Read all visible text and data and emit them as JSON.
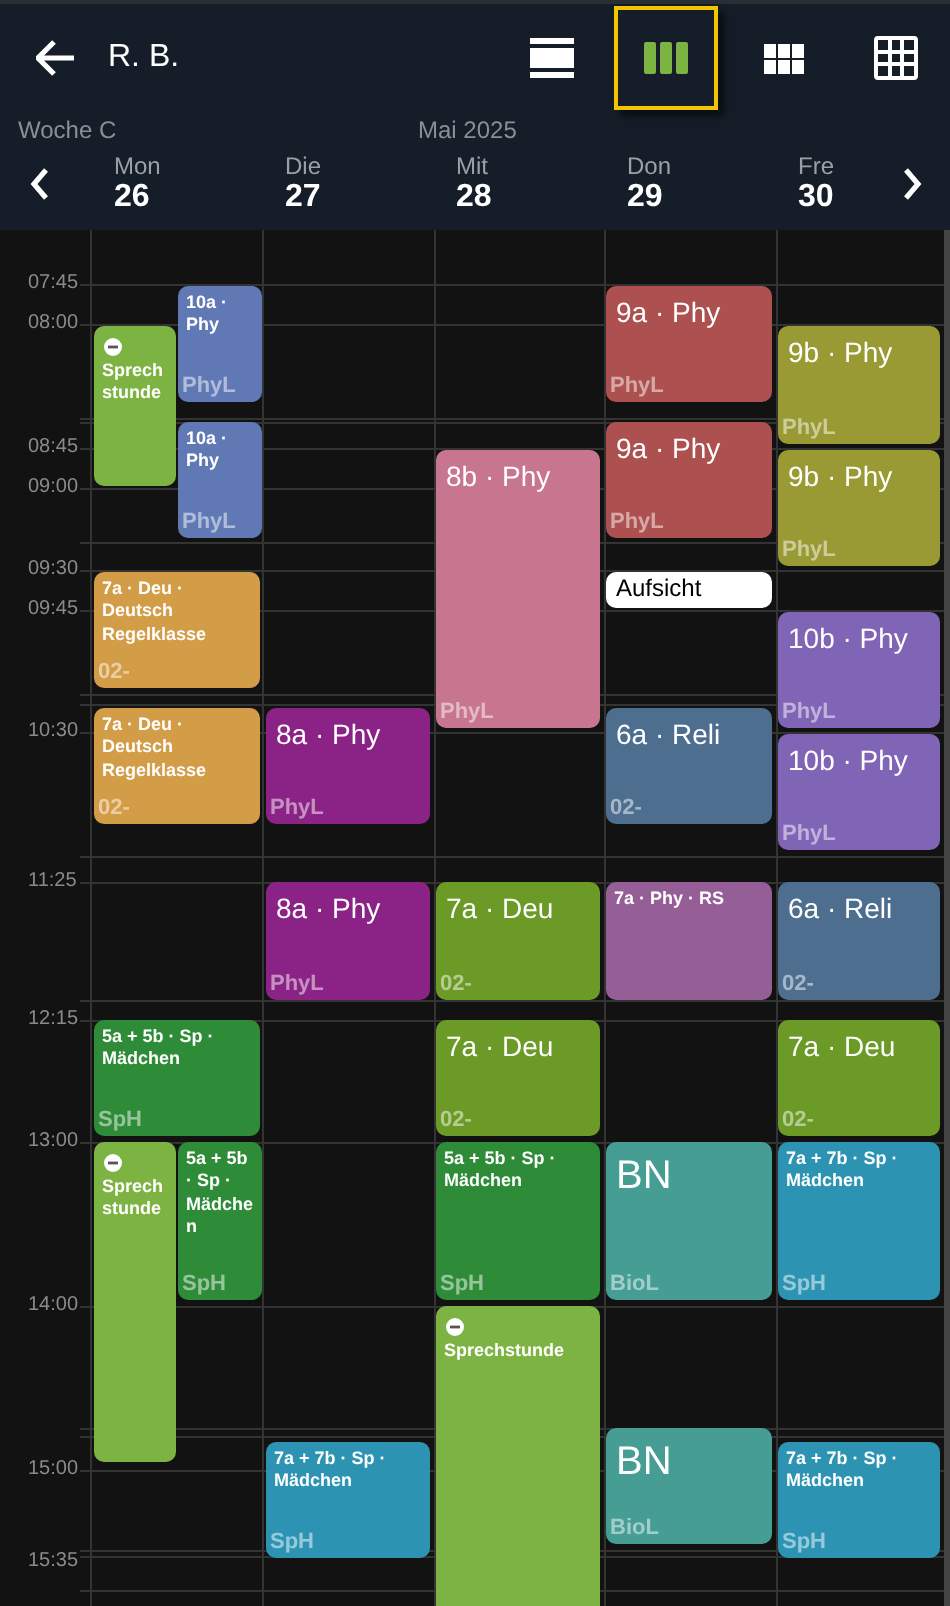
{
  "header": {
    "title": "R. B.",
    "views": [
      {
        "kind": "rows",
        "selected": false
      },
      {
        "kind": "columns",
        "selected": true
      },
      {
        "kind": "small-grid",
        "selected": false
      },
      {
        "kind": "big-grid",
        "selected": false
      }
    ]
  },
  "week": {
    "label": "Woche C",
    "month": "Mai 2025"
  },
  "times": [
    "07:45",
    "08:00",
    "08:45",
    "09:00",
    "09:30",
    "09:45",
    "10:30",
    "11:25",
    "12:15",
    "13:00",
    "14:00",
    "15:00",
    "15:35"
  ],
  "days": [
    {
      "name": "Mon",
      "date": "26",
      "events": [
        {
          "kind": "note",
          "title": "Sprechstunde",
          "color": "#7cb342"
        },
        {
          "kind": "lesson",
          "title": "10a · Phy",
          "room": "PhyL",
          "color": "#6079b5"
        },
        {
          "kind": "lesson",
          "title": "10a · Phy",
          "room": "PhyL",
          "color": "#6079b5"
        },
        {
          "kind": "lesson",
          "title": "7a · Deu · Deutsch Regelklasse",
          "room": "02-",
          "color": "#d39c46"
        },
        {
          "kind": "lesson",
          "title": "7a · Deu · Deutsch Regelklasse",
          "room": "02-",
          "color": "#d39c46"
        },
        {
          "kind": "lesson",
          "title": "5a + 5b · Sp · Mädchen",
          "room": "SpH",
          "color": "#2e8b37"
        },
        {
          "kind": "note",
          "title": "Sprechstunde",
          "color": "#7cb342"
        },
        {
          "kind": "lesson",
          "title": "5a + 5b · Sp · Mädchen",
          "room": "SpH",
          "color": "#2e8b37"
        }
      ]
    },
    {
      "name": "Die",
      "date": "27",
      "events": [
        {
          "kind": "lesson",
          "title": "8a · Phy",
          "room": "PhyL",
          "color": "#8b2386"
        },
        {
          "kind": "lesson",
          "title": "8a · Phy",
          "room": "PhyL",
          "color": "#8b2386"
        },
        {
          "kind": "lesson",
          "title": "7a + 7b · Sp · Mädchen",
          "room": "SpH",
          "color": "#2c93b2"
        }
      ]
    },
    {
      "name": "Mit",
      "date": "28",
      "events": [
        {
          "kind": "lesson",
          "title": "8b · Phy",
          "room": "PhyL",
          "color": "#c8758f"
        },
        {
          "kind": "lesson",
          "title": "7a · Deu",
          "room": "02-",
          "color": "#6b9a26"
        },
        {
          "kind": "lesson",
          "title": "7a · Deu",
          "room": "02-",
          "color": "#6b9a26"
        },
        {
          "kind": "lesson",
          "title": "5a + 5b · Sp · Mädchen",
          "room": "SpH",
          "color": "#2e8b37"
        },
        {
          "kind": "note",
          "title": "Sprechstunde",
          "color": "#7cb342"
        }
      ]
    },
    {
      "name": "Don",
      "date": "29",
      "events": [
        {
          "kind": "lesson",
          "title": "9a · Phy",
          "room": "PhyL",
          "color": "#ad5050"
        },
        {
          "kind": "lesson",
          "title": "9a · Phy",
          "room": "PhyL",
          "color": "#ad5050"
        },
        {
          "kind": "duty",
          "title": "Aufsicht",
          "color": "#ffffff"
        },
        {
          "kind": "lesson",
          "title": "6a · Reli",
          "room": "02-",
          "color": "#4d6e8e"
        },
        {
          "kind": "lesson",
          "title": "7a · Phy · RS",
          "color": "#965e96"
        },
        {
          "kind": "lesson",
          "title": "BN",
          "room": "BioL",
          "color": "#459d94"
        },
        {
          "kind": "lesson",
          "title": "BN",
          "room": "BioL",
          "color": "#459d94"
        }
      ]
    },
    {
      "name": "Fre",
      "date": "30",
      "events": [
        {
          "kind": "lesson",
          "title": "9b · Phy",
          "room": "PhyL",
          "color": "#9a9a35"
        },
        {
          "kind": "lesson",
          "title": "9b · Phy",
          "room": "PhyL",
          "color": "#9a9a35"
        },
        {
          "kind": "lesson",
          "title": "10b · Phy",
          "room": "PhyL",
          "color": "#8064b6"
        },
        {
          "kind": "lesson",
          "title": "10b · Phy",
          "room": "PhyL",
          "color": "#8064b6"
        },
        {
          "kind": "lesson",
          "title": "6a · Reli",
          "room": "02-",
          "color": "#4d6e8e"
        },
        {
          "kind": "lesson",
          "title": "7a · Deu",
          "room": "02-",
          "color": "#6b9a26"
        },
        {
          "kind": "lesson",
          "title": "7a + 7b · Sp · Mädchen",
          "room": "SpH",
          "color": "#2c93b2"
        },
        {
          "kind": "lesson",
          "title": "7a + 7b · Sp · Mädchen",
          "room": "SpH",
          "color": "#2c93b2"
        }
      ]
    }
  ]
}
